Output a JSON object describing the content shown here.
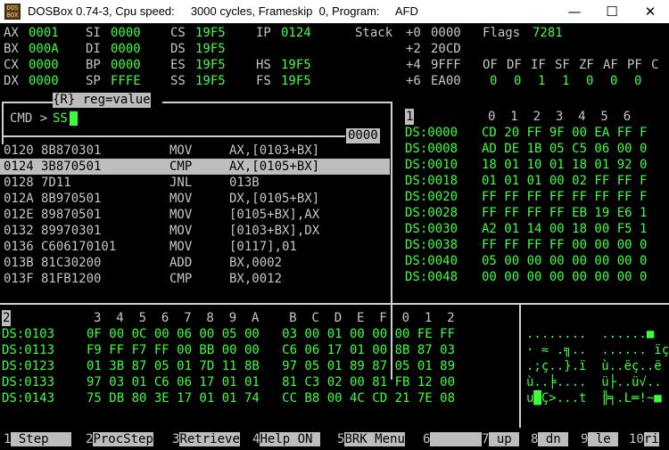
{
  "window": {
    "title": "DOSBox 0.74-3, Cpu speed:     3000 cycles, Frameskip  0, Program:     AFD",
    "logo_text": "DOS BOX",
    "minimize_glyph": "—",
    "maximize_glyph": "☐",
    "close_glyph": "✕"
  },
  "registers": {
    "rows": [
      [
        {
          "name": "AX",
          "value": "0001"
        },
        {
          "name": "SI",
          "value": "0000"
        },
        {
          "name": "CS",
          "value": "19F5"
        },
        {
          "name": "IP",
          "value": "0124"
        }
      ],
      [
        {
          "name": "BX",
          "value": "000A"
        },
        {
          "name": "DI",
          "value": "0000"
        },
        {
          "name": "DS",
          "value": "19F5"
        }
      ],
      [
        {
          "name": "CX",
          "value": "0000"
        },
        {
          "name": "BP",
          "value": "0000"
        },
        {
          "name": "ES",
          "value": "19F5"
        },
        {
          "name": "HS",
          "value": "19F5"
        }
      ],
      [
        {
          "name": "DX",
          "value": "0000"
        },
        {
          "name": "SP",
          "value": "FFFE"
        },
        {
          "name": "SS",
          "value": "19F5"
        },
        {
          "name": "FS",
          "value": "19F5"
        }
      ]
    ]
  },
  "stack": {
    "label": "Stack",
    "rows": [
      {
        "offset": "+0",
        "value": "0000"
      },
      {
        "offset": "+2",
        "value": "20CD"
      },
      {
        "offset": "+4",
        "value": "9FFF"
      },
      {
        "offset": "+6",
        "value": "EA00"
      }
    ]
  },
  "flags": {
    "label": "Flags",
    "value": "7281",
    "names": [
      "OF",
      "DF",
      "IF",
      "SF",
      "ZF",
      "AF",
      "PF",
      "C"
    ],
    "values": [
      "0",
      "0",
      "1",
      "1",
      "0",
      "0",
      "0"
    ]
  },
  "cmd": {
    "hint": "{R} reg=value",
    "prompt": "CMD >",
    "input": "SS",
    "offset": "0000"
  },
  "disasm": {
    "selected_index": 1,
    "rows": [
      {
        "addr": "0120",
        "bytes": "8B870301",
        "mnemonic": "MOV",
        "operands": "AX,[0103+BX]"
      },
      {
        "addr": "0124",
        "bytes": "3B870501",
        "mnemonic": "CMP",
        "operands": "AX,[0105+BX]"
      },
      {
        "addr": "0128",
        "bytes": "7D11",
        "mnemonic": "JNL",
        "operands": "013B"
      },
      {
        "addr": "012A",
        "bytes": "8B970501",
        "mnemonic": "MOV",
        "operands": "DX,[0105+BX]"
      },
      {
        "addr": "012E",
        "bytes": "89870501",
        "mnemonic": "MOV",
        "operands": "[0105+BX],AX"
      },
      {
        "addr": "0132",
        "bytes": "89970301",
        "mnemonic": "MOV",
        "operands": "[0103+BX],DX"
      },
      {
        "addr": "0136",
        "bytes": "C606170101",
        "mnemonic": "MOV",
        "operands": "[0117],01"
      },
      {
        "addr": "013B",
        "bytes": "81C30200",
        "mnemonic": "ADD",
        "operands": "BX,0002"
      },
      {
        "addr": "013F",
        "bytes": "81FB1200",
        "mnemonic": "CMP",
        "operands": "BX,0012"
      }
    ]
  },
  "dump1": {
    "panel_number": "1",
    "header": "0  1  2  3  4  5  6",
    "rows": [
      {
        "addr": "DS:0000",
        "bytes": "CD 20 FF 9F 00 EA FF F"
      },
      {
        "addr": "DS:0008",
        "bytes": "AD DE 1B 05 C5 06 00 0"
      },
      {
        "addr": "DS:0010",
        "bytes": "18 01 10 01 18 01 92 0"
      },
      {
        "addr": "DS:0018",
        "bytes": "01 01 01 00 02 FF FF F"
      },
      {
        "addr": "DS:0020",
        "bytes": "FF FF FF FF FF FF FF F"
      },
      {
        "addr": "DS:0028",
        "bytes": "FF FF FF FF EB 19 E6 1"
      },
      {
        "addr": "DS:0030",
        "bytes": "A2 01 14 00 18 00 F5 1"
      },
      {
        "addr": "DS:0038",
        "bytes": "FF FF FF FF 00 00 00 0"
      },
      {
        "addr": "DS:0040",
        "bytes": "05 00 00 00 00 00 00 0"
      },
      {
        "addr": "DS:0048",
        "bytes": "00 00 00 00 00 00 00 0"
      }
    ]
  },
  "dump2": {
    "panel_number": "2",
    "header": "3  4  5  6  7  8  9  A    B  C  D  E  F  0  1  2",
    "rows": [
      {
        "addr": "DS:0103",
        "bytes": "0F 00 0C 00 06 00 05 00   03 00 01 00 00 00 FE FF",
        "ascii": "........  ......■"
      },
      {
        "addr": "DS:0113",
        "bytes": "F9 FF F7 FF 00 BB 00 00   C6 06 17 01 00 8B 87 03",
        "ascii": "· ≈ .╗..  ...... ïç"
      },
      {
        "addr": "DS:0123",
        "bytes": "01 3B 87 05 01 7D 11 8B   97 05 01 89 87 05 01 89",
        "ascii": ".;ç..}.ï  ù..ëç..ë"
      },
      {
        "addr": "DS:0133",
        "bytes": "97 03 01 C6 06 17 01 01   81 C3 02 00 81 FB 12 00",
        "ascii": "ù..╞....  ü├..ü√.."
      },
      {
        "addr": "DS:0143",
        "bytes": "75 DB 80 3E 17 01 01 74   CC B8 00 4C CD 21 7E 08",
        "ascii": "u█Ç>...t  ╠╕.L═!~■"
      }
    ]
  },
  "keys": [
    {
      "num": "1",
      "label": " Step   "
    },
    {
      "num": "2",
      "label": "ProcStep"
    },
    {
      "num": "3",
      "label": "Retrieve"
    },
    {
      "num": "4",
      "label": "Help ON "
    },
    {
      "num": "5",
      "label": "BRK Menu"
    },
    {
      "num": "6",
      "label": "        "
    },
    {
      "num": "7",
      "label": " up "
    },
    {
      "num": "8",
      "label": " dn "
    },
    {
      "num": "9",
      "label": " le "
    },
    {
      "num": "10",
      "label": "ri"
    }
  ]
}
